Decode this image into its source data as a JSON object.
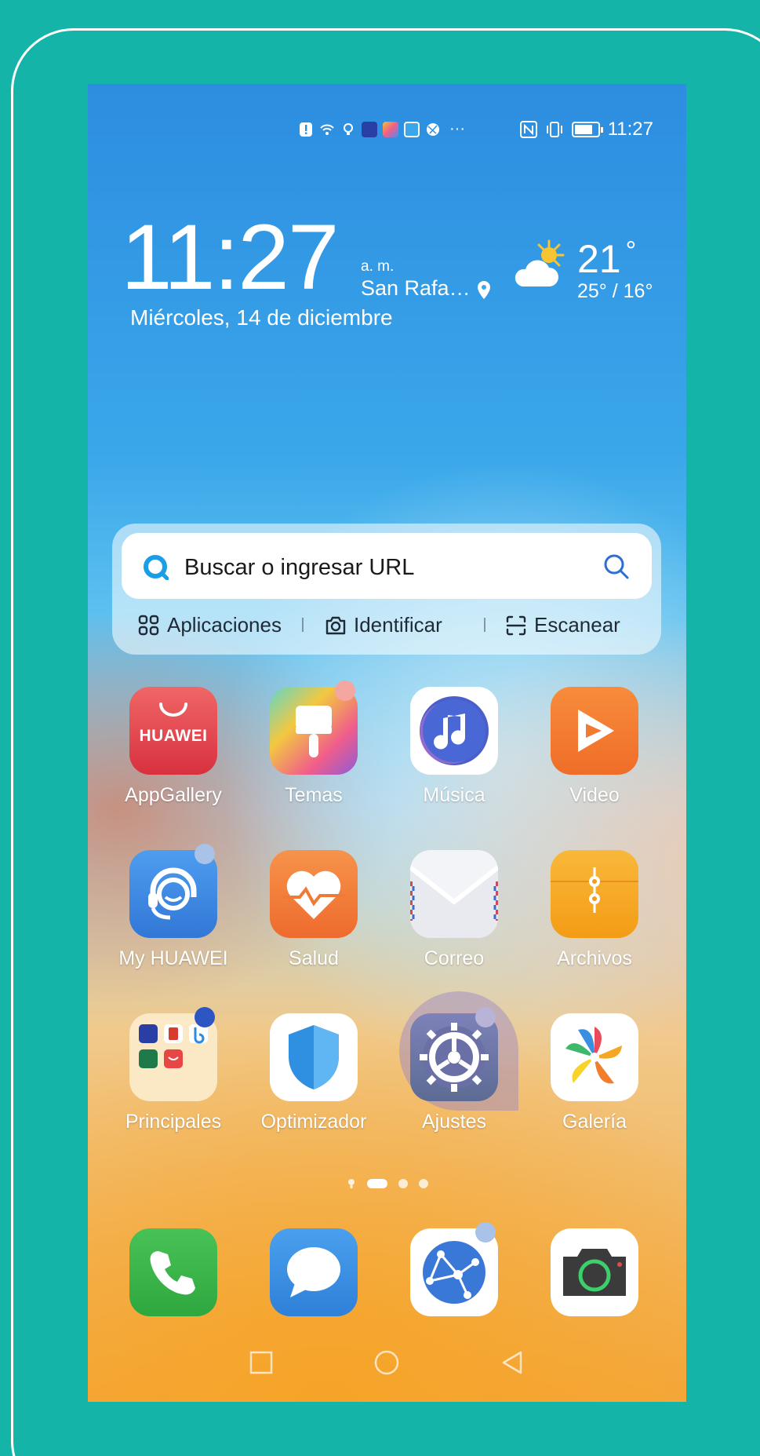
{
  "status_bar": {
    "time": "11:27",
    "notification_icons": [
      "alert-icon",
      "wifi-icon",
      "bulb-icon",
      "app-notif-icon-1",
      "app-notif-icon-2",
      "petal-search-notif-icon",
      "browser-notif-icon"
    ],
    "more_indicator": "···",
    "system_icons": [
      "nfc-icon",
      "vibrate-icon",
      "battery-icon"
    ]
  },
  "clock_widget": {
    "time": "11:27",
    "ampm": "a. m.",
    "city": "San Rafa…",
    "date": "Miércoles, 14 de diciembre",
    "temperature": "21",
    "temp_unit": "°",
    "temp_range": "25° / 16°",
    "weather_icon": "partly-sunny-icon"
  },
  "search_widget": {
    "placeholder": "Buscar o ingresar URL",
    "actions": [
      {
        "label": "Aplicaciones",
        "icon": "apps-grid-icon"
      },
      {
        "label": "Identificar",
        "icon": "camera-outline-icon"
      },
      {
        "label": "Escanear",
        "icon": "scan-icon"
      }
    ]
  },
  "apps": [
    {
      "label": "AppGallery",
      "icon": "appgallery-icon",
      "brand_text": "HUAWEI",
      "color": "#ec4b55"
    },
    {
      "label": "Temas",
      "icon": "themes-brush-icon",
      "color": "#f06292"
    },
    {
      "label": "Música",
      "icon": "music-note-icon",
      "color": "#ffffff"
    },
    {
      "label": "Video",
      "icon": "video-play-icon",
      "color": "#f57c30"
    },
    {
      "label": "My HUAWEI",
      "icon": "support-headset-icon",
      "color": "#3f8fe6"
    },
    {
      "label": "Salud",
      "icon": "health-heart-icon",
      "color": "#f47b3b"
    },
    {
      "label": "Correo",
      "icon": "mail-envelope-icon",
      "color": "#ffffff"
    },
    {
      "label": "Archivos",
      "icon": "files-folder-icon",
      "color": "#f7a928"
    },
    {
      "label": "Principales",
      "icon": "folder-principales-icon",
      "color": "#fbe9c8"
    },
    {
      "label": "Optimizador",
      "icon": "shield-icon",
      "color": "#ffffff"
    },
    {
      "label": "Ajustes",
      "icon": "settings-gear-icon",
      "color": "#5c6b94"
    },
    {
      "label": "Galería",
      "icon": "gallery-pinwheel-icon",
      "color": "#ffffff"
    }
  ],
  "dock": [
    {
      "name": "phone",
      "icon": "phone-icon",
      "color": "#3db34a"
    },
    {
      "name": "messages",
      "icon": "message-bubble-icon",
      "color": "#3a8fe0"
    },
    {
      "name": "browser",
      "icon": "browser-globe-icon",
      "color": "#ffffff"
    },
    {
      "name": "camera",
      "icon": "camera-icon",
      "color": "#ffffff"
    }
  ],
  "navigation": [
    "recents-square-icon",
    "home-circle-icon",
    "back-triangle-icon"
  ]
}
